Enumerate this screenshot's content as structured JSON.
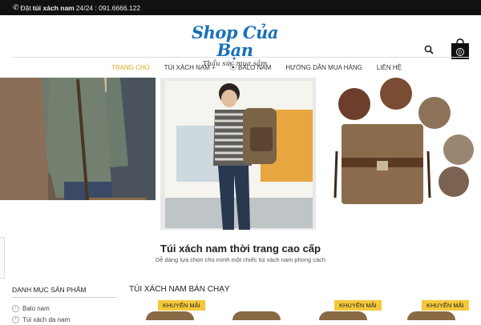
{
  "topbar": {
    "prefix": "Đặt",
    "bold": "túi xách nam",
    "suffix": "24/24 : 091.6666.122"
  },
  "logo": {
    "brand": "Shop Của Bạn",
    "tagline": "Thẩu sức mua sắm"
  },
  "cart": {
    "count": "0"
  },
  "nav": {
    "items": [
      "TRANG CHỦ",
      "TÚI XÁCH NAM +",
      "BALO NAM",
      "HƯỚNG DẪN MUA HÀNG",
      "LIÊN HỆ"
    ]
  },
  "section": {
    "title": "Túi xách nam thời trang cao cấp",
    "subtitle": "Dễ dàng lựa chọn cho mình một chiếc túi xách nam phong cách"
  },
  "sidebar": {
    "title": "DANH MỤC SẢN PHẨM",
    "items": [
      "Balo nam",
      "Túi xách da nam"
    ]
  },
  "products": {
    "title": "TÚI XÁCH NAM BÁN CHẠY",
    "badge": "KHUYẾN MÃI"
  },
  "colors": {
    "accent": "#d8a521",
    "brand": "#1b6fb8",
    "topbar": "#111111",
    "badge": "#f4c83a"
  }
}
